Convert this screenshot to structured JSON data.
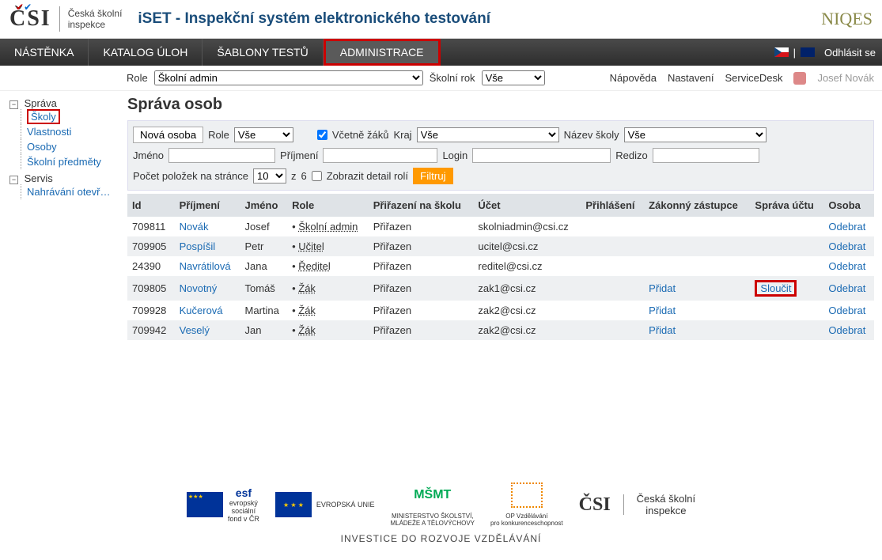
{
  "header": {
    "logo": "ČSI",
    "logo_sub_1": "Česká školní",
    "logo_sub_2": "inspekce",
    "app_title": "iSET - Inspekční systém elektronického testování",
    "niqes": "NIQES"
  },
  "nav": {
    "items": [
      "NÁSTĚNKA",
      "KATALOG ÚLOH",
      "ŠABLONY TESTŮ",
      "ADMINISTRACE"
    ],
    "logout": "Odhlásit se"
  },
  "subbar": {
    "role_label": "Role",
    "role_value": "Školní admin",
    "year_label": "Školní rok",
    "year_value": "Vše",
    "links": [
      "Nápověda",
      "Nastavení",
      "ServiceDesk"
    ],
    "user": "Josef Novák"
  },
  "sidebar": {
    "sprava": "Správa",
    "items_sprava": [
      "Školy",
      "Vlastnosti",
      "Osoby",
      "Školní předměty"
    ],
    "servis": "Servis",
    "items_servis": [
      "Nahrávání otevř…"
    ]
  },
  "page": {
    "title": "Správa osob"
  },
  "filter": {
    "new": "Nová osoba",
    "role_label": "Role",
    "role_value": "Vše",
    "vcetne": "Včetně žáků",
    "kraj_label": "Kraj",
    "kraj_value": "Vše",
    "nazev_label": "Název školy",
    "nazev_value": "Vše",
    "jmeno_label": "Jméno",
    "prijmeni_label": "Příjmení",
    "login_label": "Login",
    "redizo_label": "Redizo",
    "perpage_label": "Počet položek na stránce",
    "perpage_value": "10",
    "z_label": "z",
    "total": "6",
    "detail": "Zobrazit detail rolí",
    "filtruj": "Filtruj"
  },
  "table": {
    "headers": [
      "Id",
      "Příjmení",
      "Jméno",
      "Role",
      "Přiřazení na školu",
      "Účet",
      "Přihlášení",
      "Zákonný zástupce",
      "Správa účtu",
      "Osoba"
    ],
    "rows": [
      {
        "id": "709811",
        "prijmeni": "Novák",
        "jmeno": "Josef",
        "role": "Školní admin",
        "prirazeni": "Přiřazen",
        "ucet": "skolniadmin@csi.cz",
        "zakonny": "",
        "sprava": "",
        "osoba": "Odebrat"
      },
      {
        "id": "709905",
        "prijmeni": "Pospíšil",
        "jmeno": "Petr",
        "role": "Učitel",
        "prirazeni": "Přiřazen",
        "ucet": "ucitel@csi.cz",
        "zakonny": "",
        "sprava": "",
        "osoba": "Odebrat"
      },
      {
        "id": "24390",
        "prijmeni": "Navrátilová",
        "jmeno": "Jana",
        "role": "Ředitel",
        "prirazeni": "Přiřazen",
        "ucet": "reditel@csi.cz",
        "zakonny": "",
        "sprava": "",
        "osoba": "Odebrat"
      },
      {
        "id": "709805",
        "prijmeni": "Novotný",
        "jmeno": "Tomáš",
        "role": "Žák",
        "prirazeni": "Přiřazen",
        "ucet": "zak1@csi.cz",
        "zakonny": "Přidat",
        "sprava": "Sloučit",
        "osoba": "Odebrat"
      },
      {
        "id": "709928",
        "prijmeni": "Kučerová",
        "jmeno": "Martina",
        "role": "Žák",
        "prirazeni": "Přiřazen",
        "ucet": "zak2@csi.cz",
        "zakonny": "Přidat",
        "sprava": "",
        "osoba": "Odebrat"
      },
      {
        "id": "709942",
        "prijmeni": "Veselý",
        "jmeno": "Jan",
        "role": "Žák",
        "prirazeni": "Přiřazen",
        "ucet": "zak2@csi.cz",
        "zakonny": "Přidat",
        "sprava": "",
        "osoba": "Odebrat"
      }
    ]
  },
  "footer": {
    "esf": "esf",
    "esf_sub": "evropský\nsociální\nfond v ČR",
    "eu": "EVROPSKÁ UNIE",
    "msmt": "MINISTERSTVO ŠKOLSTVÍ,\nMLÁDEŽE A TĚLOVÝCHOVY",
    "op": "OP Vzdělávání\npro konkurenceschopnost",
    "csi": "ČSI",
    "csi_sub": "Česká školní\ninspekce",
    "caption": "INVESTICE DO ROZVOJE VZDĚLÁVÁNÍ"
  }
}
